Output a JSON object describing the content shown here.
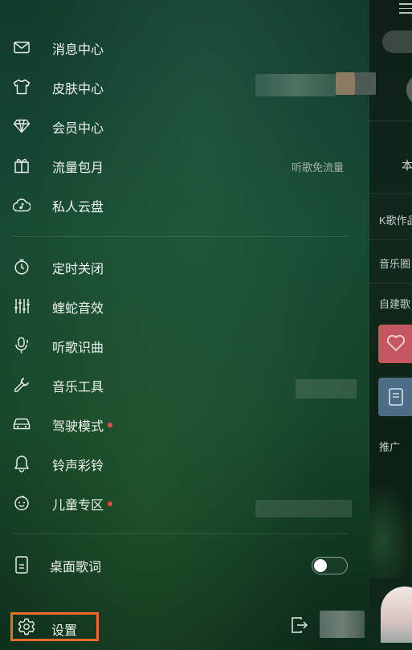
{
  "drawer": {
    "groups": [
      {
        "items": [
          {
            "icon": "mail-icon",
            "label": "消息中心"
          },
          {
            "icon": "tshirt-icon",
            "label": "皮肤中心"
          },
          {
            "icon": "diamond-icon",
            "label": "会员中心"
          },
          {
            "icon": "gift-icon",
            "label": "流量包月",
            "extra": "听歌免流量"
          },
          {
            "icon": "cloud-music-icon",
            "label": "私人云盘"
          }
        ]
      },
      {
        "items": [
          {
            "icon": "timer-icon",
            "label": "定时关闭"
          },
          {
            "icon": "equalizer-icon",
            "label": "蝰蛇音效"
          },
          {
            "icon": "mic-recognize-icon",
            "label": "听歌识曲"
          },
          {
            "icon": "wrench-icon",
            "label": "音乐工具"
          },
          {
            "icon": "car-icon",
            "label": "驾驶模式",
            "badge": "red-dot"
          },
          {
            "icon": "bell-icon",
            "label": "铃声彩铃"
          },
          {
            "icon": "kids-face-icon",
            "label": "儿童专区",
            "badge": "red-dot"
          }
        ]
      }
    ],
    "desktop_lyrics": {
      "icon": "phone-lyrics-icon",
      "label": "桌面歌词",
      "toggle_on": false
    },
    "footer": {
      "settings_label": "设置",
      "settings_icon": "gear-icon",
      "logout_icon": "exit-icon"
    }
  },
  "main_page": {
    "menu_icon": "hamburger-icon",
    "tab_partial": "本",
    "rows": [
      "K歌作品",
      "音乐圈",
      "自建歌",
      "推广"
    ]
  },
  "colors": {
    "highlight_border": "#ef6a2a",
    "badge_red": "#ea4b4b",
    "love_thumb": "#c4575f",
    "doc_thumb": "#4d6d86"
  }
}
